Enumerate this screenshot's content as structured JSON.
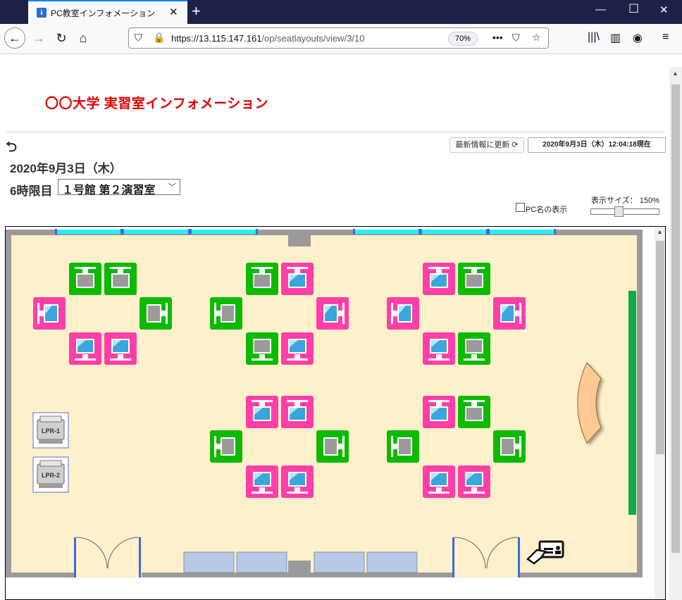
{
  "browser": {
    "tab_title": "PC教室インフォメーション",
    "tab_favicon": "i",
    "url_host": "https://13.115.147.161",
    "url_path": "/op/seatlayouts/view/3/10",
    "zoom": "70%"
  },
  "header": {
    "site_title": "〇〇大学 実習室インフォメーション",
    "refresh_label": "最新情報に更新",
    "timestamp": "2020年9月3日（木）12:04:18現在"
  },
  "date_heading": "2020年9月3日（木）",
  "period_label": "6時限目",
  "room_select": {
    "value": "１号館 第２演習室"
  },
  "pc_name_label": "PC名の表示",
  "display_size_label": "表示サイズ：",
  "display_size_value": "150%",
  "seat_status_colors": {
    "occupied": "#ff3fa8",
    "available": "#0cbb00"
  },
  "printers": [
    {
      "label": "LPR-1"
    },
    {
      "label": "LPR-2"
    }
  ],
  "seat_groups": [
    [
      "available",
      "available",
      "occupied",
      "available",
      "occupied",
      "occupied"
    ],
    [
      "available",
      "occupied",
      "available",
      "occupied",
      "available",
      "occupied"
    ],
    [
      "occupied",
      "available",
      "occupied",
      "occupied",
      "occupied",
      "available"
    ],
    [
      "occupied",
      "occupied",
      "available",
      "available",
      "occupied",
      "occupied"
    ],
    [
      "occupied",
      "available",
      "available",
      "available",
      "occupied",
      "occupied"
    ]
  ]
}
